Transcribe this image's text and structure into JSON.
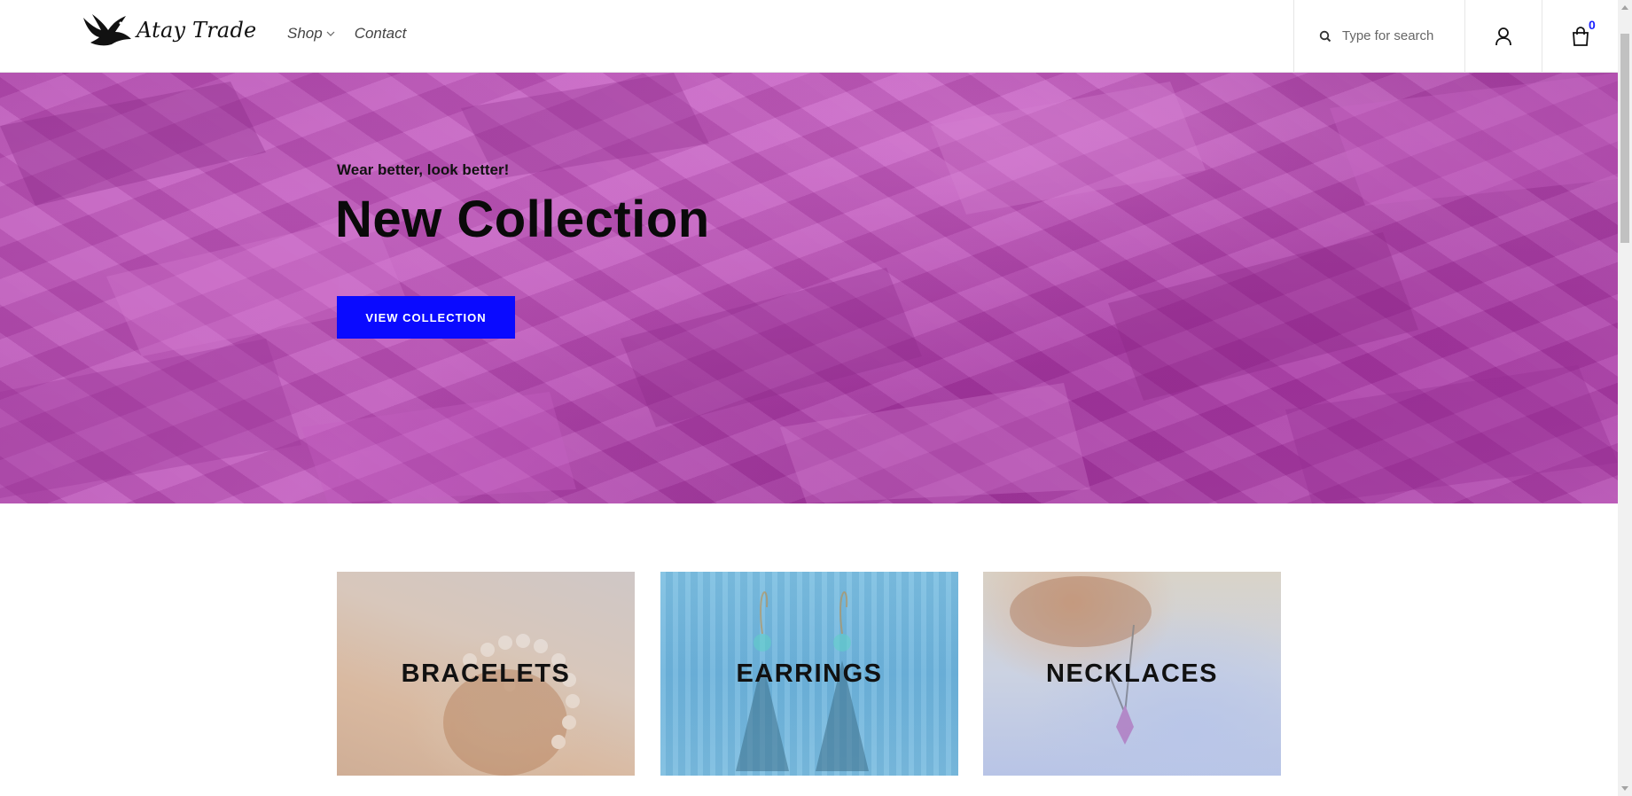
{
  "header": {
    "brand": "Atay Trade",
    "nav": [
      {
        "label": "Shop",
        "has_dropdown": true
      },
      {
        "label": "Contact",
        "has_dropdown": false
      }
    ],
    "search": {
      "placeholder": "Type for search",
      "value": ""
    },
    "icons": {
      "search": "search-icon",
      "account": "user-icon",
      "cart": "shopping-bag-icon"
    },
    "cart_count": "0"
  },
  "hero": {
    "subtitle": "Wear better, look better!",
    "title": "New Collection",
    "button_label": "VIEW COLLECTION"
  },
  "categories": [
    {
      "label": "BRACELETS"
    },
    {
      "label": "EARRINGS"
    },
    {
      "label": "NECKLACES"
    }
  ],
  "colors": {
    "accent": "#0a0aff",
    "hero_bg": "#b04aad",
    "cart_badge": "#1a22ff"
  }
}
